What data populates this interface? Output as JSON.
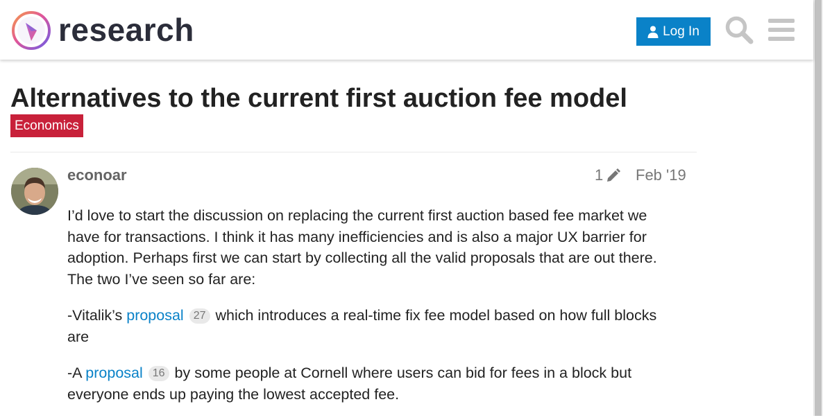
{
  "header": {
    "logo_text": "research",
    "login_label": "Log In"
  },
  "topic": {
    "title": "Alternatives to the current first auction fee model",
    "category": "Economics",
    "category_color": "#c8213a"
  },
  "post": {
    "username": "econoar",
    "edit_count": "1",
    "date": "Feb '19",
    "paragraph1": "I’d love to start the discussion on replacing the current first auction based fee market we have for transactions. I think it has many inefficiencies and is also a major UX barrier for adoption. Perhaps first we can start by collecting all the valid proposals that are out there. The two I’ve seen so far are:",
    "item1": {
      "prefix": "-Vitalik’s ",
      "link": "proposal",
      "clicks": "27",
      "suffix": " which introduces a real-time fix fee model based on how full blocks are"
    },
    "item2": {
      "prefix": "-A ",
      "link": "proposal",
      "clicks": "16",
      "suffix": " by some people at Cornell where users can bid for fees in a block but everyone ends up paying the lowest accepted fee."
    }
  },
  "colors": {
    "accent": "#0a82c8",
    "text": "#222222",
    "muted": "#777777"
  },
  "icons": {
    "logo": "research-logo-icon",
    "login": "user-icon",
    "search": "search-icon",
    "menu": "hamburger-menu-icon",
    "edit": "pencil-icon"
  }
}
